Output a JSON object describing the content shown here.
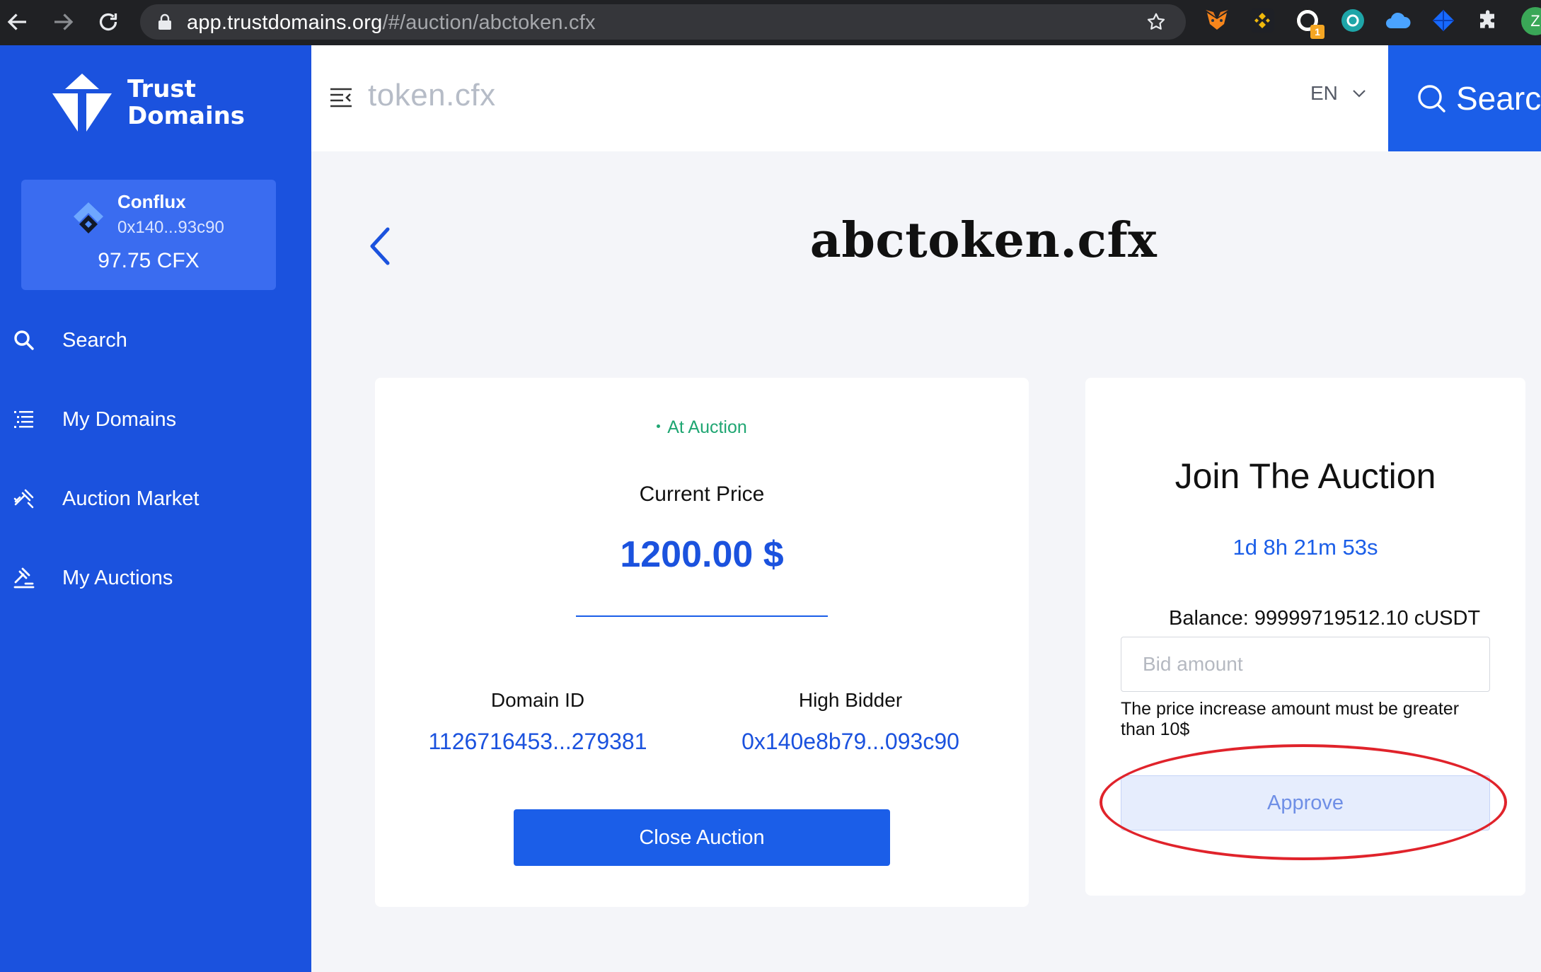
{
  "browser": {
    "url_host": "app.trustdomains.org",
    "url_path": "/#/auction/abctoken.cfx",
    "extensions": [
      "metamask-icon",
      "binance-wallet-icon",
      "ring-extension-icon",
      "conflux-portal-icon",
      "cloud-extension-icon",
      "diamond-extension-icon",
      "puzzle-extensions-icon"
    ],
    "extension_badge": "1",
    "profile_initial": "Z"
  },
  "brand": {
    "line1": "Trust",
    "line2": "Domains"
  },
  "wallet": {
    "network": "Conflux",
    "address": "0x140...93c90",
    "balance": "97.75 CFX"
  },
  "sidebar": {
    "items": [
      {
        "label": "Search",
        "icon": "search-icon"
      },
      {
        "label": "My Domains",
        "icon": "list-icon"
      },
      {
        "label": "Auction Market",
        "icon": "gavel-icon"
      },
      {
        "label": "My Auctions",
        "icon": "auction-hammer-icon"
      }
    ]
  },
  "header": {
    "title": "token.cfx",
    "language": "EN",
    "search_label": "Searc"
  },
  "page": {
    "title": "abctoken.cfx"
  },
  "auction": {
    "status": "At Auction",
    "price_label": "Current Price",
    "price_value": "1200.00 $",
    "domain_id_label": "Domain ID",
    "domain_id_value": "1126716453...279381",
    "high_bidder_label": "High Bidder",
    "high_bidder_value": "0x140e8b79...093c90",
    "close_label": "Close Auction"
  },
  "join": {
    "title": "Join The Auction",
    "countdown": "1d 8h 21m 53s",
    "balance": "Balance: 99999719512.10 cUSDT",
    "bid_placeholder": "Bid amount",
    "bid_value": "",
    "hint": "The price increase amount must be greater than 10$",
    "approve_label": "Approve"
  },
  "colors": {
    "sidebar": "#1b52de",
    "accent": "#1b5ee8",
    "status_green": "#1fa672",
    "highlight_red": "#e0232b"
  }
}
